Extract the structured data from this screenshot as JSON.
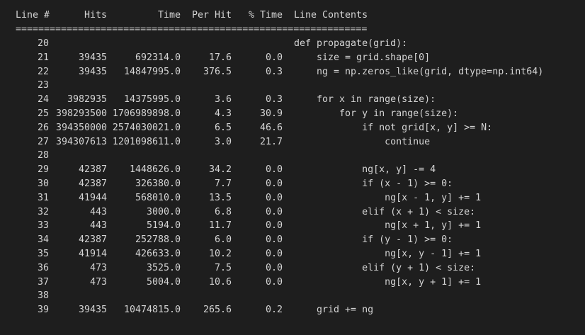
{
  "header": {
    "line": "Line #",
    "hits": "Hits",
    "time": "Time",
    "per_hit": "Per Hit",
    "pct_time": "% Time",
    "contents": "Line Contents"
  },
  "separator": "==============================================================",
  "rows": [
    {
      "line": "20",
      "hits": "",
      "time": "",
      "per_hit": "",
      "pct": "",
      "code": "def propagate(grid):"
    },
    {
      "line": "21",
      "hits": "39435",
      "time": "692314.0",
      "per_hit": "17.6",
      "pct": "0.0",
      "code": "    size = grid.shape[0]"
    },
    {
      "line": "22",
      "hits": "39435",
      "time": "14847995.0",
      "per_hit": "376.5",
      "pct": "0.3",
      "code": "    ng = np.zeros_like(grid, dtype=np.int64)"
    },
    {
      "line": "23",
      "hits": "",
      "time": "",
      "per_hit": "",
      "pct": "",
      "code": ""
    },
    {
      "line": "24",
      "hits": "3982935",
      "time": "14375995.0",
      "per_hit": "3.6",
      "pct": "0.3",
      "code": "    for x in range(size):"
    },
    {
      "line": "25",
      "hits": "398293500",
      "time": "1706989898.0",
      "per_hit": "4.3",
      "pct": "30.9",
      "code": "        for y in range(size):"
    },
    {
      "line": "26",
      "hits": "394350000",
      "time": "2574030021.0",
      "per_hit": "6.5",
      "pct": "46.6",
      "code": "            if not grid[x, y] >= N:"
    },
    {
      "line": "27",
      "hits": "394307613",
      "time": "1201098611.0",
      "per_hit": "3.0",
      "pct": "21.7",
      "code": "                continue"
    },
    {
      "line": "28",
      "hits": "",
      "time": "",
      "per_hit": "",
      "pct": "",
      "code": ""
    },
    {
      "line": "29",
      "hits": "42387",
      "time": "1448626.0",
      "per_hit": "34.2",
      "pct": "0.0",
      "code": "            ng[x, y] -= 4"
    },
    {
      "line": "30",
      "hits": "42387",
      "time": "326380.0",
      "per_hit": "7.7",
      "pct": "0.0",
      "code": "            if (x - 1) >= 0:"
    },
    {
      "line": "31",
      "hits": "41944",
      "time": "568010.0",
      "per_hit": "13.5",
      "pct": "0.0",
      "code": "                ng[x - 1, y] += 1"
    },
    {
      "line": "32",
      "hits": "443",
      "time": "3000.0",
      "per_hit": "6.8",
      "pct": "0.0",
      "code": "            elif (x + 1) < size:"
    },
    {
      "line": "33",
      "hits": "443",
      "time": "5194.0",
      "per_hit": "11.7",
      "pct": "0.0",
      "code": "                ng[x + 1, y] += 1"
    },
    {
      "line": "34",
      "hits": "42387",
      "time": "252788.0",
      "per_hit": "6.0",
      "pct": "0.0",
      "code": "            if (y - 1) >= 0:"
    },
    {
      "line": "35",
      "hits": "41914",
      "time": "426633.0",
      "per_hit": "10.2",
      "pct": "0.0",
      "code": "                ng[x, y - 1] += 1"
    },
    {
      "line": "36",
      "hits": "473",
      "time": "3525.0",
      "per_hit": "7.5",
      "pct": "0.0",
      "code": "            elif (y + 1) < size:"
    },
    {
      "line": "37",
      "hits": "473",
      "time": "5004.0",
      "per_hit": "10.6",
      "pct": "0.0",
      "code": "                ng[x, y + 1] += 1"
    },
    {
      "line": "38",
      "hits": "",
      "time": "",
      "per_hit": "",
      "pct": "",
      "code": ""
    },
    {
      "line": "39",
      "hits": "39435",
      "time": "10474815.0",
      "per_hit": "265.6",
      "pct": "0.2",
      "code": "    grid += ng"
    }
  ]
}
